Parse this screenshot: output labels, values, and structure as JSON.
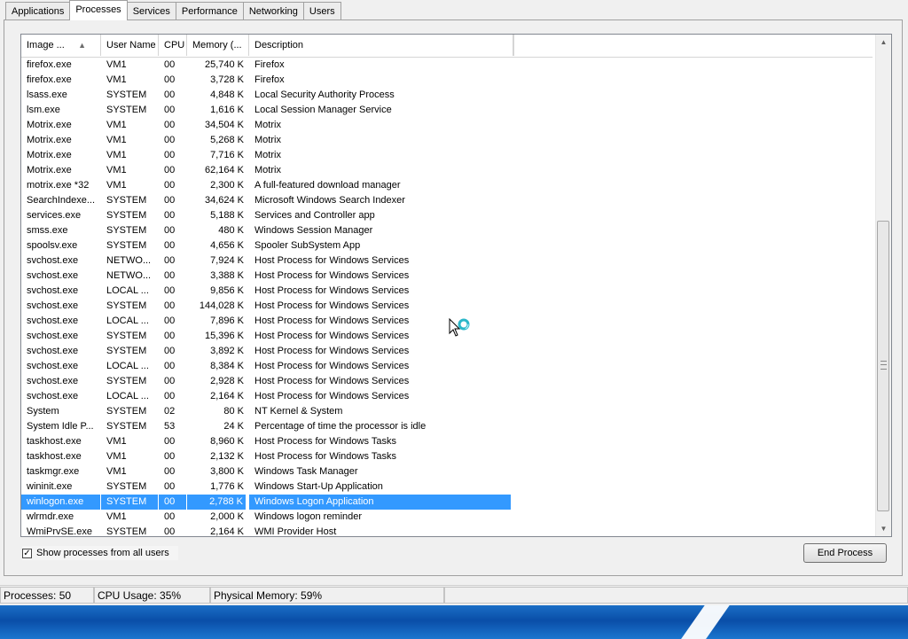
{
  "tabs": [
    "Applications",
    "Processes",
    "Services",
    "Performance",
    "Networking",
    "Users"
  ],
  "active_tab": "Processes",
  "columns": [
    "Image ...",
    "User Name",
    "CPU",
    "Memory (...",
    "Description"
  ],
  "processes": [
    {
      "image": "firefox.exe",
      "user": "VM1",
      "cpu": "00",
      "mem": "25,740 K",
      "desc": "Firefox"
    },
    {
      "image": "firefox.exe",
      "user": "VM1",
      "cpu": "00",
      "mem": "3,728 K",
      "desc": "Firefox"
    },
    {
      "image": "lsass.exe",
      "user": "SYSTEM",
      "cpu": "00",
      "mem": "4,848 K",
      "desc": "Local Security Authority Process"
    },
    {
      "image": "lsm.exe",
      "user": "SYSTEM",
      "cpu": "00",
      "mem": "1,616 K",
      "desc": "Local Session Manager Service"
    },
    {
      "image": "Motrix.exe",
      "user": "VM1",
      "cpu": "00",
      "mem": "34,504 K",
      "desc": "Motrix"
    },
    {
      "image": "Motrix.exe",
      "user": "VM1",
      "cpu": "00",
      "mem": "5,268 K",
      "desc": "Motrix"
    },
    {
      "image": "Motrix.exe",
      "user": "VM1",
      "cpu": "00",
      "mem": "7,716 K",
      "desc": "Motrix"
    },
    {
      "image": "Motrix.exe",
      "user": "VM1",
      "cpu": "00",
      "mem": "62,164 K",
      "desc": "Motrix"
    },
    {
      "image": "motrix.exe *32",
      "user": "VM1",
      "cpu": "00",
      "mem": "2,300 K",
      "desc": "A full-featured download manager"
    },
    {
      "image": "SearchIndexe...",
      "user": "SYSTEM",
      "cpu": "00",
      "mem": "34,624 K",
      "desc": "Microsoft Windows Search Indexer"
    },
    {
      "image": "services.exe",
      "user": "SYSTEM",
      "cpu": "00",
      "mem": "5,188 K",
      "desc": "Services and Controller app"
    },
    {
      "image": "smss.exe",
      "user": "SYSTEM",
      "cpu": "00",
      "mem": "480 K",
      "desc": "Windows Session Manager"
    },
    {
      "image": "spoolsv.exe",
      "user": "SYSTEM",
      "cpu": "00",
      "mem": "4,656 K",
      "desc": "Spooler SubSystem App"
    },
    {
      "image": "svchost.exe",
      "user": "NETWO...",
      "cpu": "00",
      "mem": "7,924 K",
      "desc": "Host Process for Windows Services"
    },
    {
      "image": "svchost.exe",
      "user": "NETWO...",
      "cpu": "00",
      "mem": "3,388 K",
      "desc": "Host Process for Windows Services"
    },
    {
      "image": "svchost.exe",
      "user": "LOCAL ...",
      "cpu": "00",
      "mem": "9,856 K",
      "desc": "Host Process for Windows Services"
    },
    {
      "image": "svchost.exe",
      "user": "SYSTEM",
      "cpu": "00",
      "mem": "144,028 K",
      "desc": "Host Process for Windows Services"
    },
    {
      "image": "svchost.exe",
      "user": "LOCAL ...",
      "cpu": "00",
      "mem": "7,896 K",
      "desc": "Host Process for Windows Services"
    },
    {
      "image": "svchost.exe",
      "user": "SYSTEM",
      "cpu": "00",
      "mem": "15,396 K",
      "desc": "Host Process for Windows Services"
    },
    {
      "image": "svchost.exe",
      "user": "SYSTEM",
      "cpu": "00",
      "mem": "3,892 K",
      "desc": "Host Process for Windows Services"
    },
    {
      "image": "svchost.exe",
      "user": "LOCAL ...",
      "cpu": "00",
      "mem": "8,384 K",
      "desc": "Host Process for Windows Services"
    },
    {
      "image": "svchost.exe",
      "user": "SYSTEM",
      "cpu": "00",
      "mem": "2,928 K",
      "desc": "Host Process for Windows Services"
    },
    {
      "image": "svchost.exe",
      "user": "LOCAL ...",
      "cpu": "00",
      "mem": "2,164 K",
      "desc": "Host Process for Windows Services"
    },
    {
      "image": "System",
      "user": "SYSTEM",
      "cpu": "02",
      "mem": "80 K",
      "desc": "NT Kernel & System"
    },
    {
      "image": "System Idle P...",
      "user": "SYSTEM",
      "cpu": "53",
      "mem": "24 K",
      "desc": "Percentage of time the processor is idle"
    },
    {
      "image": "taskhost.exe",
      "user": "VM1",
      "cpu": "00",
      "mem": "8,960 K",
      "desc": "Host Process for Windows Tasks"
    },
    {
      "image": "taskhost.exe",
      "user": "VM1",
      "cpu": "00",
      "mem": "2,132 K",
      "desc": "Host Process for Windows Tasks"
    },
    {
      "image": "taskmgr.exe",
      "user": "VM1",
      "cpu": "00",
      "mem": "3,800 K",
      "desc": "Windows Task Manager"
    },
    {
      "image": "wininit.exe",
      "user": "SYSTEM",
      "cpu": "00",
      "mem": "1,776 K",
      "desc": "Windows Start-Up Application"
    },
    {
      "image": "winlogon.exe",
      "user": "SYSTEM",
      "cpu": "00",
      "mem": "2,788 K",
      "desc": "Windows Logon Application",
      "selected": true
    },
    {
      "image": "wlrmdr.exe",
      "user": "VM1",
      "cpu": "00",
      "mem": "2,000 K",
      "desc": "Windows logon reminder"
    },
    {
      "image": "WmiPrvSE.exe",
      "user": "SYSTEM",
      "cpu": "00",
      "mem": "2,164 K",
      "desc": "WMI Provider Host"
    }
  ],
  "show_all_label": "Show processes from all users",
  "show_all_checked": true,
  "end_process_label": "End Process",
  "status": {
    "processes": "Processes: 50",
    "cpu": "CPU Usage: 35%",
    "memory": "Physical Memory: 59%"
  },
  "colors": {
    "selection": "#3399ff",
    "taskbar": "#1a6fc6"
  },
  "icons": {
    "sort": "sort-up-arrow-icon",
    "scroll_up": "scroll-up-arrow-icon",
    "scroll_down": "scroll-down-arrow-icon",
    "cursor": "busy-cursor-icon"
  }
}
